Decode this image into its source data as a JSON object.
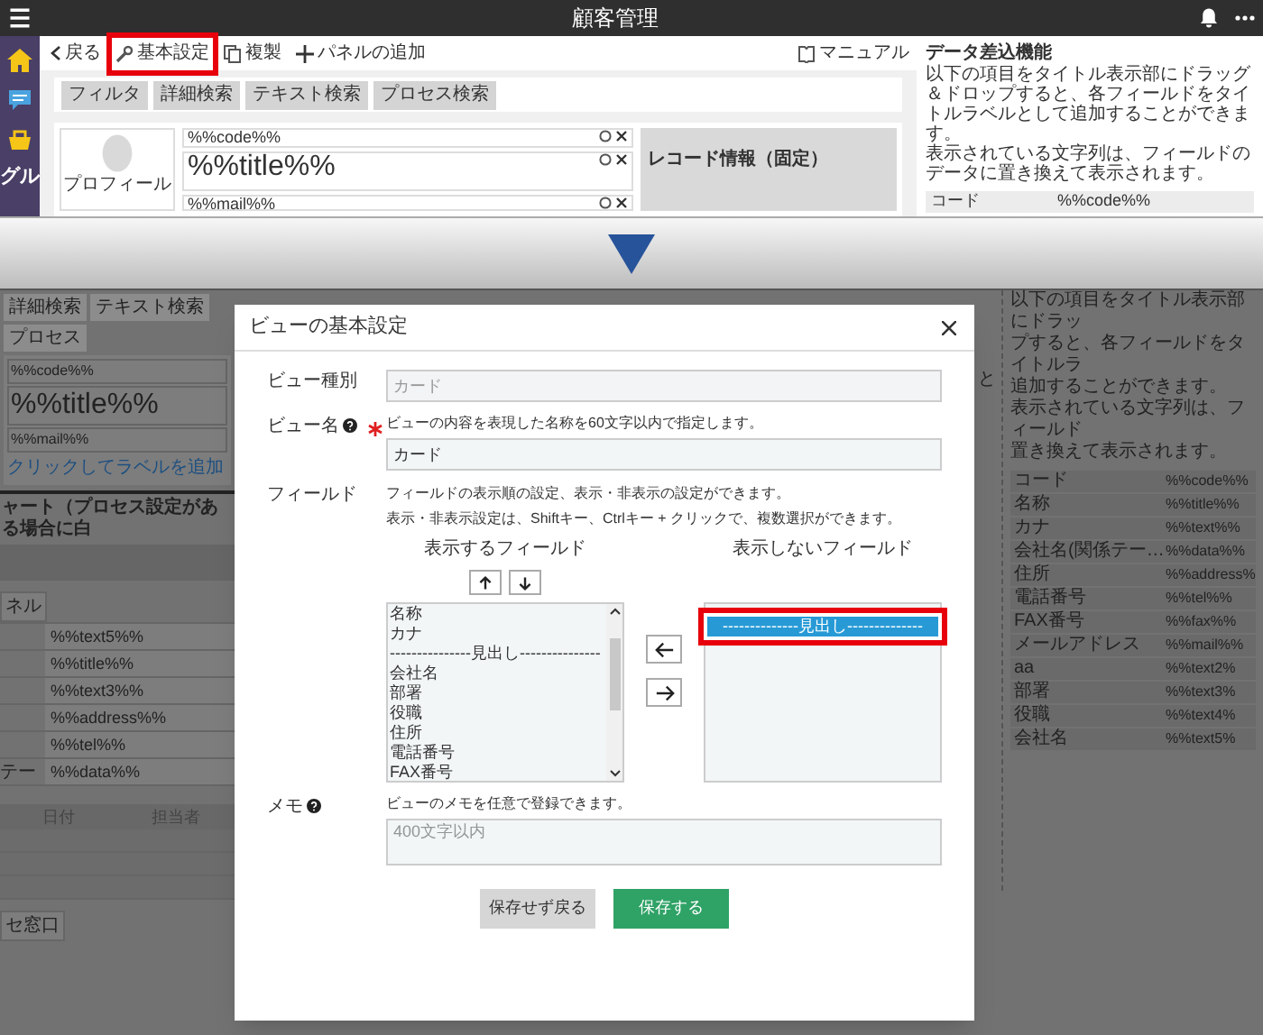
{
  "header": {
    "title": "顧客管理"
  },
  "sidebar": {
    "label": "グル"
  },
  "toolbar": {
    "items": [
      {
        "kind": "back",
        "label": "戻る",
        "highlighted": false
      },
      {
        "kind": "settings",
        "label": "基本設定",
        "highlighted": true
      },
      {
        "kind": "copy",
        "label": "複製",
        "highlighted": false
      },
      {
        "kind": "add",
        "label": "パネルの追加",
        "highlighted": false
      }
    ],
    "manual": "マニュアル"
  },
  "filters": [
    "フィルタ",
    "詳細検索",
    "テキスト検索",
    "プロセス検索"
  ],
  "card": {
    "profile": "プロフィール",
    "code": "%%code%%",
    "title": "%%title%%",
    "mail": "%%mail%%",
    "record_info": "レコード情報（固定）"
  },
  "data_panel": {
    "title": "データ差込機能",
    "paragraphs": [
      "以下の項目をタイトル表示部にドラッグ＆ドロップすると、各フィールドをタイトルラベルとして追加することができます。",
      "表示されている文字列は、フィールドのデータに置き換えて表示されます。"
    ],
    "rows": [
      {
        "label": "コード",
        "value": "%%code%%"
      }
    ]
  },
  "background_left": {
    "tabs": [
      "詳細検索",
      "テキスト検索",
      "プロセス"
    ],
    "card": {
      "code": "%%code%%",
      "title": "%%title%%",
      "mail": "%%mail%%",
      "add_label": "クリックしてラベルを追加"
    },
    "section_heading": "ャート（プロセス設定がある場合に白",
    "panel_tab": "ネル",
    "field_rows": [
      {
        "value": "%%text5%%"
      },
      {
        "value": "%%title%%"
      },
      {
        "value": "%%text3%%"
      },
      {
        "value": "%%address%%"
      },
      {
        "value": "%%tel%%"
      },
      {
        "label": "テー",
        "value": "%%data%%"
      }
    ],
    "history_columns": [
      "日付",
      "担当者"
    ],
    "section_tab": "セ窓口"
  },
  "background_right": {
    "fragment": "と",
    "lines": [
      "以下の項目をタイトル表示部にドラッ",
      "プすると、各フィールドをタイトルラ",
      "追加することができます。",
      "表示されている文字列は、フィールド",
      "置き換えて表示されます。"
    ],
    "rows": [
      {
        "label": "コード",
        "value": "%%code%%"
      },
      {
        "label": "名称",
        "value": "%%title%%"
      },
      {
        "label": "カナ",
        "value": "%%text%%"
      },
      {
        "label": "会社名(関係テー…",
        "value": "%%data%%"
      },
      {
        "label": "住所",
        "value": "%%address%"
      },
      {
        "label": "電話番号",
        "value": "%%tel%%"
      },
      {
        "label": "FAX番号",
        "value": "%%fax%%"
      },
      {
        "label": "メールアドレス",
        "value": "%%mail%%"
      },
      {
        "label": "aa",
        "value": "%%text2%"
      },
      {
        "label": "部署",
        "value": "%%text3%"
      },
      {
        "label": "役職",
        "value": "%%text4%"
      },
      {
        "label": "会社名",
        "value": "%%text5%"
      }
    ]
  },
  "dialog": {
    "title": "ビューの基本設定",
    "view_type": {
      "label": "ビュー種別",
      "value": "カード",
      "disabled": true
    },
    "view_name": {
      "label": "ビュー名",
      "required": true,
      "hint": "ビューの内容を表現した名称を60文字以内で指定します。",
      "value": "カード"
    },
    "fields": {
      "label": "フィールド",
      "notes": [
        "フィールドの表示順の設定、表示・非表示の設定ができます。",
        "表示・非表示設定は、Shiftキー、Ctrlキー + クリックで、複数選択ができます。"
      ],
      "shown_title": "表示するフィールド",
      "hidden_title": "表示しないフィールド",
      "shown": [
        {
          "label": "名称",
          "selected": false
        },
        {
          "label": "カナ",
          "selected": false
        },
        {
          "label": "---------------見出し---------------",
          "selected": false
        },
        {
          "label": "会社名",
          "selected": false
        },
        {
          "label": "部署",
          "selected": false
        },
        {
          "label": "役職",
          "selected": false
        },
        {
          "label": "住所",
          "selected": false
        },
        {
          "label": "電話番号",
          "selected": false
        },
        {
          "label": "FAX番号",
          "selected": false
        }
      ],
      "hidden": [
        {
          "label": "--------------見出し--------------",
          "selected": true,
          "highlighted": true
        }
      ]
    },
    "memo": {
      "label": "メモ",
      "hint": "ビューのメモを任意で登録できます。",
      "placeholder": "400文字以内"
    },
    "buttons": [
      {
        "label": "保存せず戻る",
        "kind": "secondary"
      },
      {
        "label": "保存する",
        "kind": "primary"
      }
    ]
  }
}
